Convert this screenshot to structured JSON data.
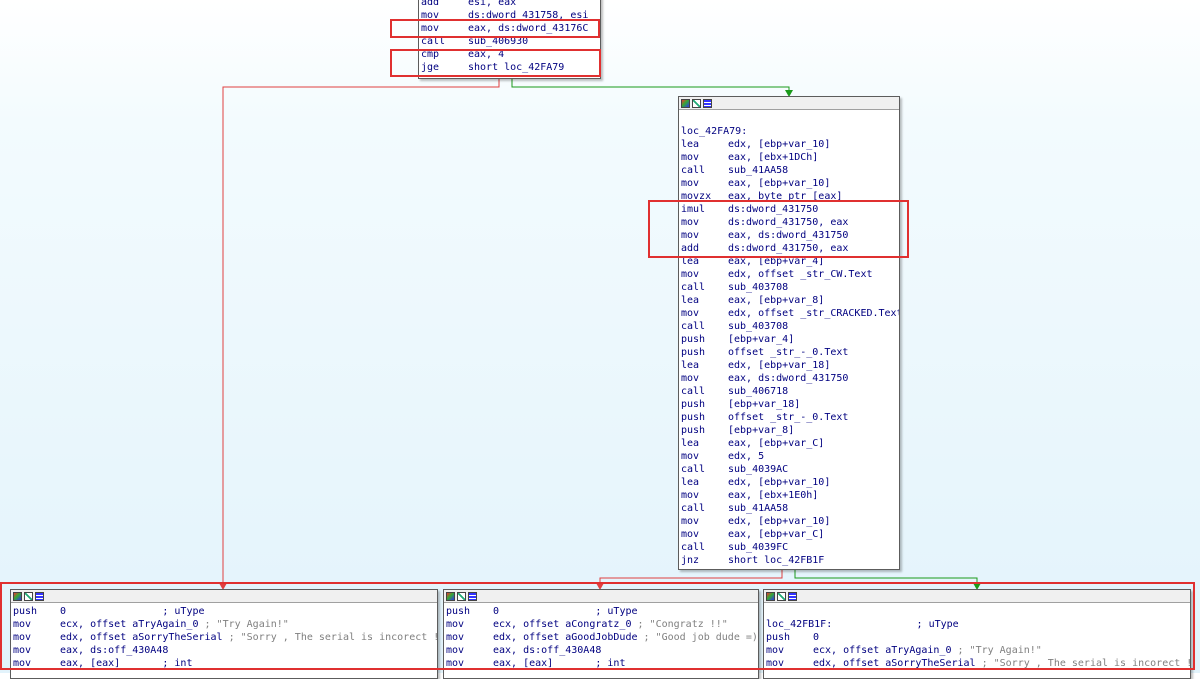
{
  "top_block": {
    "lines": [
      {
        "mn": "add",
        "op": "esi, eax"
      },
      {
        "mn": "mov",
        "op": "ds:dword_431758, esi"
      },
      {
        "mn": "mov",
        "op": "eax, ds:dword_43176C"
      },
      {
        "mn": "call",
        "op": "sub_406930"
      },
      {
        "mn": "cmp",
        "op": "eax, 4"
      },
      {
        "mn": "jge",
        "op": "short loc_42FA79"
      }
    ]
  },
  "mid_block": {
    "label": "loc_42FA79:",
    "lines": [
      {
        "mn": "lea",
        "op": "edx, [ebp+var_10]"
      },
      {
        "mn": "mov",
        "op": "eax, [ebx+1DCh]"
      },
      {
        "mn": "call",
        "op": "sub_41AA58"
      },
      {
        "mn": "mov",
        "op": "eax, [ebp+var_10]"
      },
      {
        "mn": "movzx",
        "op": "eax, byte ptr [eax]"
      },
      {
        "mn": "imul",
        "op": "ds:dword_431750"
      },
      {
        "mn": "mov",
        "op": "ds:dword_431750, eax"
      },
      {
        "mn": "mov",
        "op": "eax, ds:dword_431750"
      },
      {
        "mn": "add",
        "op": "ds:dword_431750, eax"
      },
      {
        "mn": "lea",
        "op": "eax, [ebp+var_4]"
      },
      {
        "mn": "mov",
        "op": "edx, offset _str_CW.Text"
      },
      {
        "mn": "call",
        "op": "sub_403708"
      },
      {
        "mn": "lea",
        "op": "eax, [ebp+var_8]"
      },
      {
        "mn": "mov",
        "op": "edx, offset _str_CRACKED.Text"
      },
      {
        "mn": "call",
        "op": "sub_403708"
      },
      {
        "mn": "push",
        "op": "[ebp+var_4]"
      },
      {
        "mn": "push",
        "op": "offset _str_-_0.Text"
      },
      {
        "mn": "lea",
        "op": "edx, [ebp+var_18]"
      },
      {
        "mn": "mov",
        "op": "eax, ds:dword_431750"
      },
      {
        "mn": "call",
        "op": "sub_406718"
      },
      {
        "mn": "push",
        "op": "[ebp+var_18]"
      },
      {
        "mn": "push",
        "op": "offset _str_-_0.Text"
      },
      {
        "mn": "push",
        "op": "[ebp+var_8]"
      },
      {
        "mn": "lea",
        "op": "eax, [ebp+var_C]"
      },
      {
        "mn": "mov",
        "op": "edx, 5"
      },
      {
        "mn": "call",
        "op": "sub_4039AC"
      },
      {
        "mn": "lea",
        "op": "edx, [ebp+var_10]"
      },
      {
        "mn": "mov",
        "op": "eax, [ebx+1E0h]"
      },
      {
        "mn": "call",
        "op": "sub_41AA58"
      },
      {
        "mn": "mov",
        "op": "edx, [ebp+var_10]"
      },
      {
        "mn": "mov",
        "op": "eax, [ebp+var_C]"
      },
      {
        "mn": "call",
        "op": "sub_4039FC"
      },
      {
        "mn": "jnz",
        "op": "short loc_42FB1F"
      }
    ]
  },
  "left_block": {
    "lines": [
      {
        "mn": "push",
        "op": "0",
        "cmt": "                ; uType"
      },
      {
        "mn": "mov",
        "op": "ecx, offset aTryAgain_0",
        "cmt": " ; \"Try Again!\""
      },
      {
        "mn": "mov",
        "op": "edx, offset aSorryTheSerial",
        "cmt": " ; \"Sorry , The serial is incorect !\""
      },
      {
        "mn": "mov",
        "op": "eax, ds:off_430A48",
        "cmt": ""
      },
      {
        "mn": "mov",
        "op": "eax, [eax]",
        "cmt": "       ; int"
      }
    ]
  },
  "center_block": {
    "lines": [
      {
        "mn": "push",
        "op": "0",
        "cmt": "                ; uType"
      },
      {
        "mn": "mov",
        "op": "ecx, offset aCongratz_0",
        "cmt": " ; \"Congratz !!\""
      },
      {
        "mn": "mov",
        "op": "edx, offset aGoodJobDude",
        "cmt": " ; \"Good job dude =)\""
      },
      {
        "mn": "mov",
        "op": "eax, ds:off_430A48",
        "cmt": ""
      },
      {
        "mn": "mov",
        "op": "eax, [eax]",
        "cmt": "       ; int"
      }
    ]
  },
  "right_block": {
    "label": "loc_42FB1F:",
    "label_cmt": "              ; uType",
    "lines": [
      {
        "mn": "push",
        "op": "0",
        "cmt": ""
      },
      {
        "mn": "mov",
        "op": "ecx, offset aTryAgain_0",
        "cmt": " ; \"Try Again!\""
      },
      {
        "mn": "mov",
        "op": "edx, offset aSorryTheSerial",
        "cmt": " ; \"Sorry , The serial is incorect !\""
      }
    ]
  },
  "colors": {
    "edge_false": "#e04040",
    "edge_true": "#1a9a1a",
    "highlight": "#e03030",
    "code_text": "#000080",
    "comment": "#808080"
  }
}
